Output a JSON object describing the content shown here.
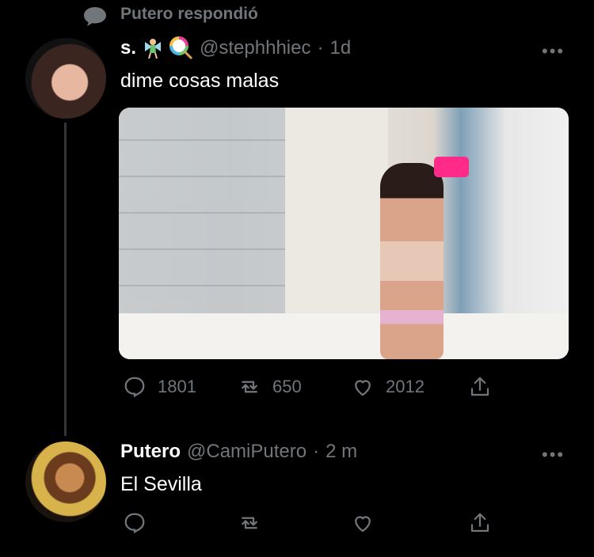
{
  "context": {
    "icon": "speech-bubble-icon",
    "text": "Putero respondió"
  },
  "tweets": [
    {
      "display_name": "s.",
      "emojis": [
        "fairy-emoji",
        "lollipop-emoji"
      ],
      "handle": "@stephhhiec",
      "separator": "·",
      "time": "1d",
      "more": "•••",
      "text": "dime cosas malas",
      "media": {
        "description": "mirror-selfie-photo"
      },
      "stats": {
        "replies": "1801",
        "retweets": "650",
        "likes": "2012"
      }
    },
    {
      "display_name": "Putero",
      "handle": "@CamiPutero",
      "separator": "·",
      "time": "2 m",
      "more": "•••",
      "text": "El Sevilla"
    }
  ],
  "colors": {
    "background": "#000000",
    "muted": "#71767b",
    "text": "#ffffff"
  }
}
